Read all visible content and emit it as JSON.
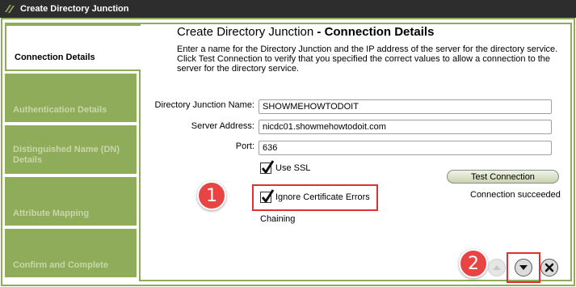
{
  "window": {
    "title": "Create Directory Junction"
  },
  "heading": {
    "prefix": "Create Directory Junction",
    "suffix": " - Connection Details"
  },
  "description": "Enter a name for the Directory Junction and the IP address of the server for the directory service. Click Test Connection to verify that you specified the correct values to allow a connection to the server for the directory service.",
  "tabs": [
    {
      "label": "Connection Details"
    },
    {
      "label": "Authentication Details"
    },
    {
      "label": "Distinguished Name (DN) Details"
    },
    {
      "label": "Attribute Mapping"
    },
    {
      "label": "Confirm and Complete"
    }
  ],
  "form": {
    "name_label": "Directory Junction Name:",
    "name_value": "SHOWMEHOWTODOIT",
    "server_label": "Server Address:",
    "server_value": "nicdc01.showmehowtodoit.com",
    "port_label": "Port:",
    "port_value": "636",
    "use_ssl_label": "Use SSL",
    "use_ssl_checked": true,
    "ignore_cert_label": "Ignore Certificate Errors",
    "ignore_cert_checked": true,
    "chaining_label": "Chaining"
  },
  "test": {
    "button_label": "Test Connection",
    "status": "Connection succeeded"
  },
  "callouts": {
    "one": "1",
    "two": "2"
  },
  "colors": {
    "tab_green": "#8fac5a",
    "highlight_red": "#e03030",
    "callout_red": "#e84444"
  }
}
